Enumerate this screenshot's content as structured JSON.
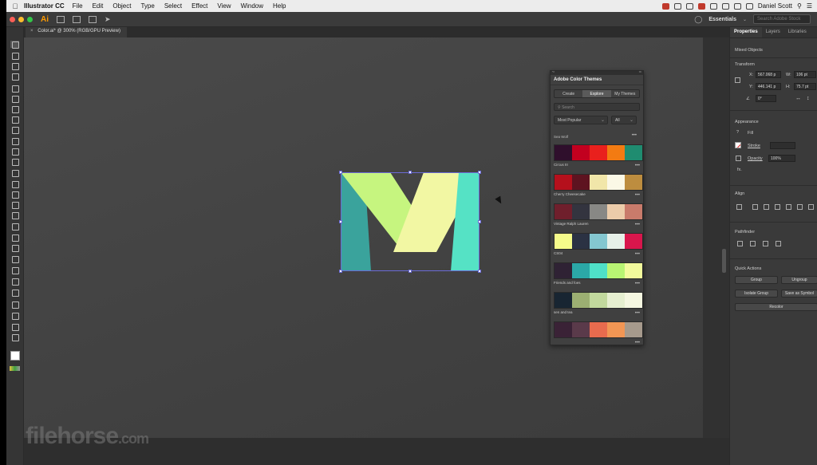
{
  "menubar": {
    "app_name": "Illustrator CC",
    "items": [
      "File",
      "Edit",
      "Object",
      "Type",
      "Select",
      "Effect",
      "View",
      "Window",
      "Help"
    ],
    "user": "Daniel Scott"
  },
  "appbar": {
    "logo": "Ai",
    "workspace": "Essentials",
    "search_placeholder": "Search Adobe Stock"
  },
  "document": {
    "tab_label": "Color.ai* @ 300% (RGB/GPU Preview)"
  },
  "artwork": {
    "colors": {
      "left_leg": "#3aa39c",
      "left_diag": "#c6f57f",
      "right_diag": "#f2f7a3",
      "right_leg": "#55e2c5"
    }
  },
  "color_themes_panel": {
    "title": "Adobe Color Themes",
    "tabs": [
      "Create",
      "Explore",
      "My Themes"
    ],
    "active_tab": "Explore",
    "search_placeholder": "Search",
    "filter_sort": "Most Popular",
    "filter_scope": "All",
    "first_partial_theme": "Sea Wolf",
    "themes": [
      {
        "name": "Circus III",
        "colors": [
          "#2f0f2c",
          "#c2001f",
          "#e9201d",
          "#f37b12",
          "#1f8c70"
        ]
      },
      {
        "name": "Cherry Cheesecake",
        "colors": [
          "#b5101c",
          "#5e1320",
          "#f1e6a9",
          "#fbf8e6",
          "#bd8d3f"
        ]
      },
      {
        "name": "Vintage Ralph Lauren",
        "colors": [
          "#6f1f2c",
          "#33343f",
          "#888885",
          "#ecccaa",
          "#c97b6b"
        ]
      },
      {
        "name": "CS04",
        "colors": [
          "#f5fb8a",
          "#2b3243",
          "#84c7d0",
          "#e6f0e8",
          "#d8164c"
        ]
      },
      {
        "name": "Friends and foes",
        "colors": [
          "#2f2234",
          "#2ba8a7",
          "#4fe0c8",
          "#b8f473",
          "#f2fa9c"
        ]
      },
      {
        "name": "sen and tea",
        "colors": [
          "#182532",
          "#9caf72",
          "#c2d99d",
          "#e6efd0",
          "#f5f7e1"
        ]
      },
      {
        "name": "",
        "colors": [
          "#3a2236",
          "#5a3a4a",
          "#e86b4e",
          "#f29654",
          "#a69a8c"
        ]
      }
    ]
  },
  "properties_panel": {
    "tabs": [
      "Properties",
      "Layers",
      "Libraries"
    ],
    "active_tab": "Properties",
    "selection": "Mixed Objects",
    "transform": {
      "heading": "Transform",
      "x": "567.068 p",
      "y": "446.141 p",
      "w": "106 pt",
      "h": "75.7 pt",
      "angle": "0°"
    },
    "appearance": {
      "heading": "Appearance",
      "fill": "Fill",
      "stroke": "Stroke",
      "opacity_label": "Opacity",
      "opacity": "100%",
      "fx": "fx."
    },
    "align_heading": "Align",
    "pathfinder_heading": "Pathfinder",
    "quick_actions": {
      "heading": "Quick Actions",
      "group": "Group",
      "ungroup": "Ungroup",
      "isolate": "Isolate Group",
      "save_symbol": "Save as Symbol",
      "recolor": "Recolor"
    }
  },
  "watermark": {
    "brand": "filehorse",
    "suffix": ".com"
  }
}
